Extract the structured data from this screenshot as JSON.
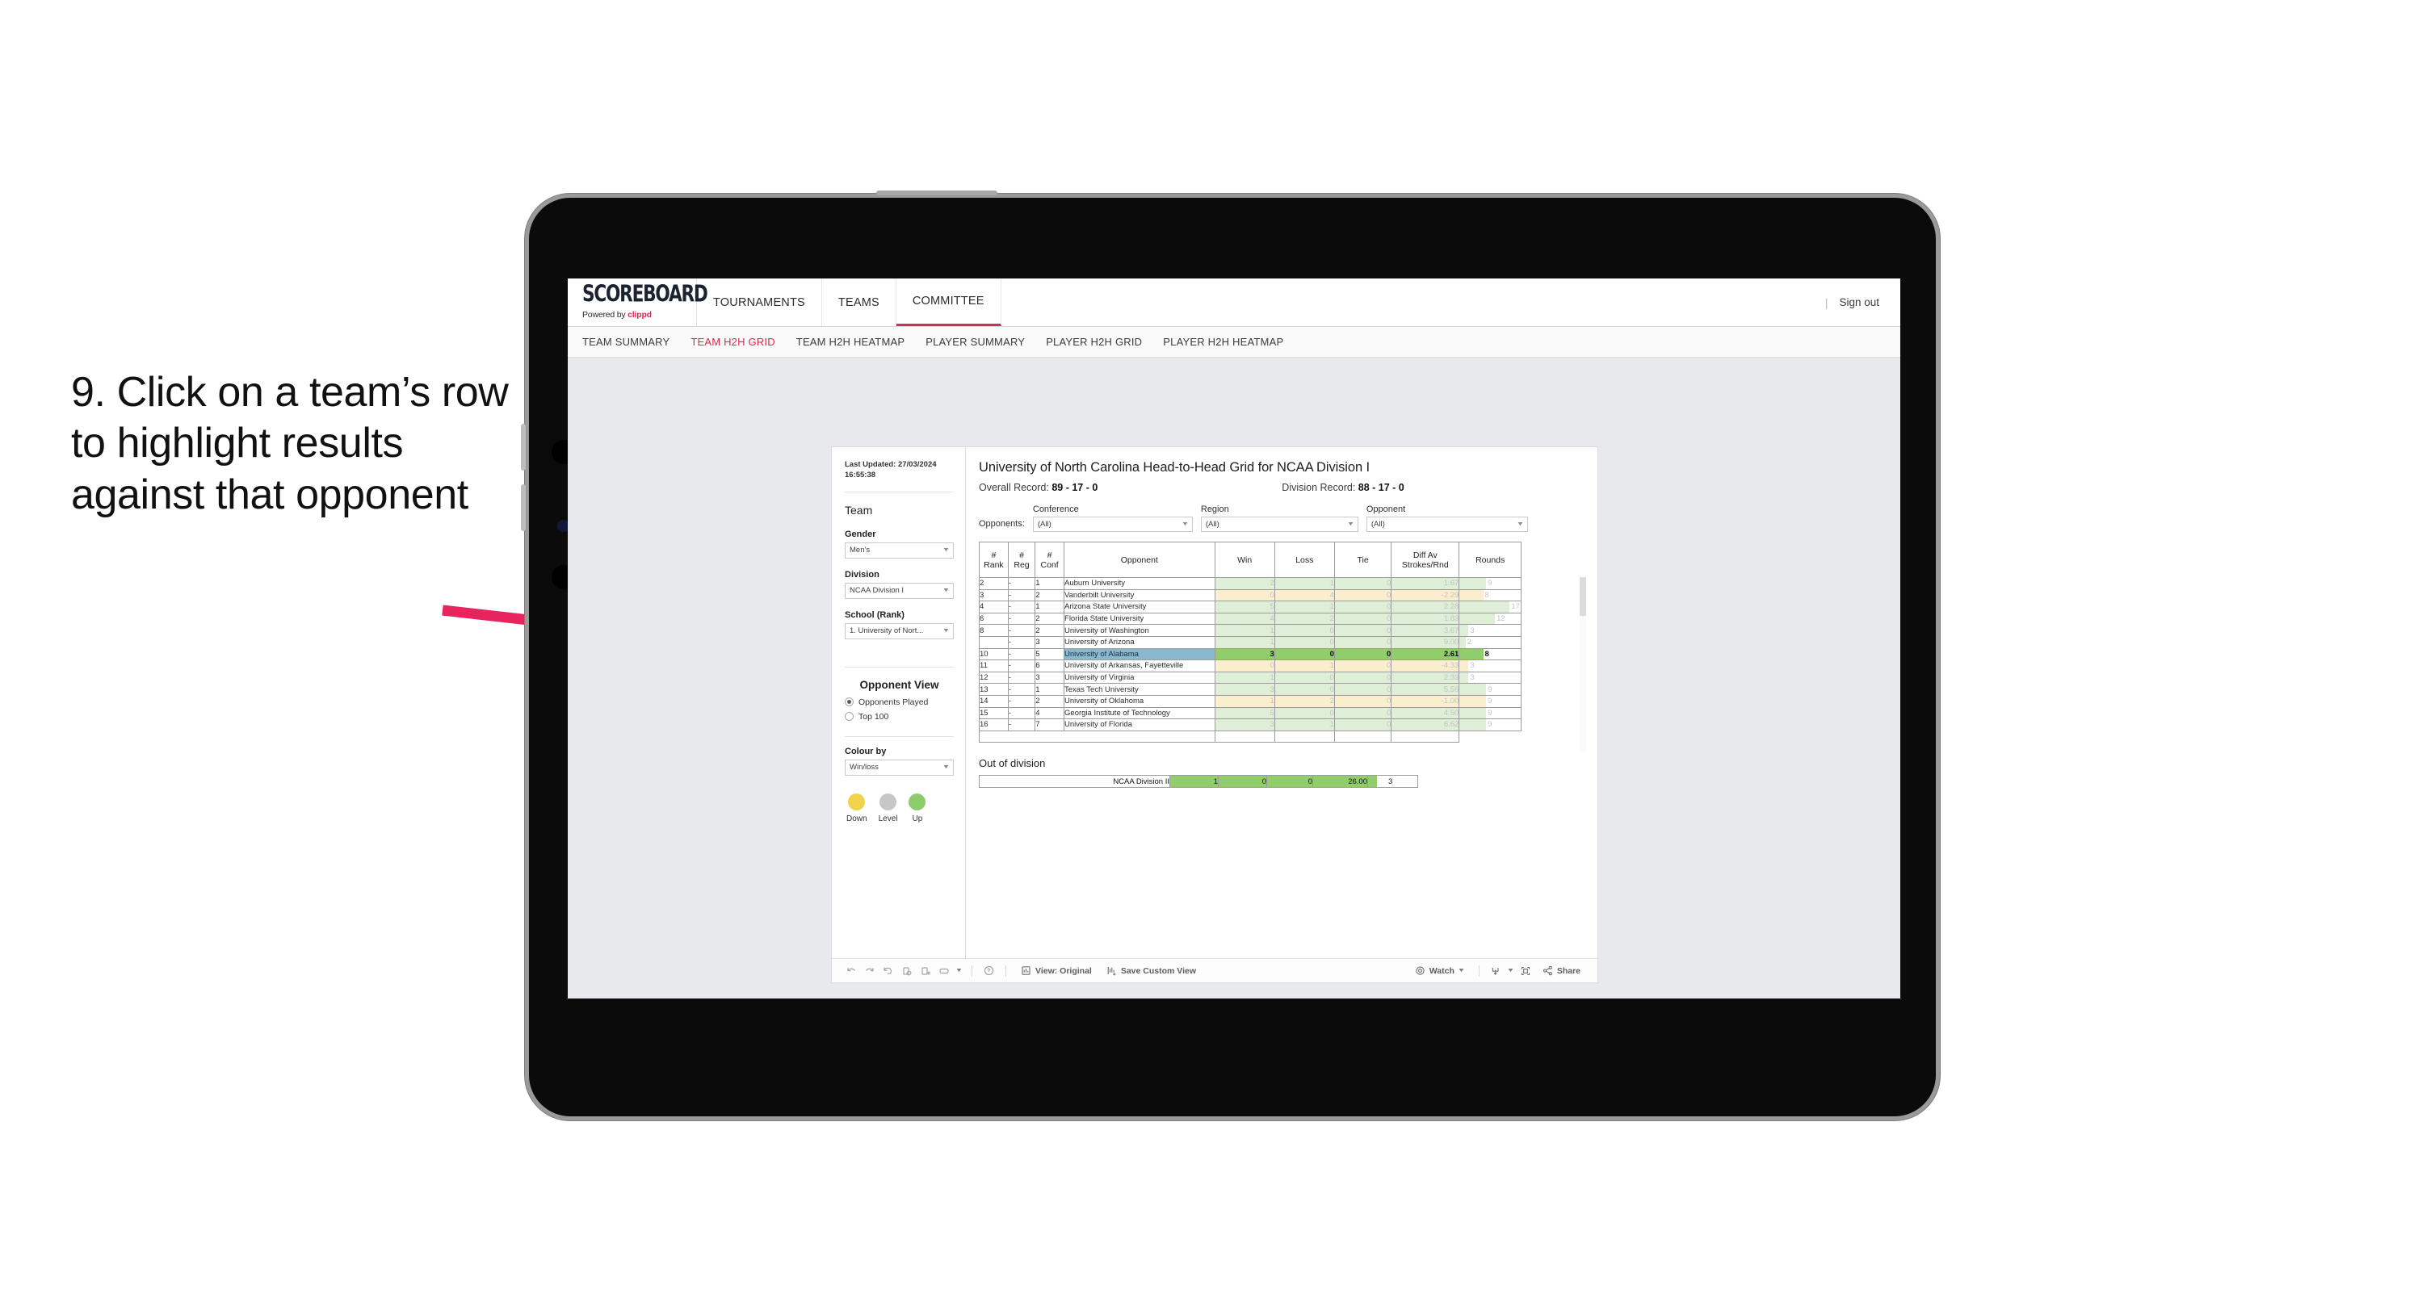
{
  "annotation": {
    "text": "9. Click on a team’s row to highlight results against that opponent",
    "arrow_color": "#e8245f"
  },
  "topbar": {
    "logo_main": "SCOREBOARD",
    "logo_sub_prefix": "Powered by ",
    "logo_sub_brand": "clippd",
    "nav": [
      {
        "label": "TOURNAMENTS",
        "active": false
      },
      {
        "label": "TEAMS",
        "active": false
      },
      {
        "label": "COMMITTEE",
        "active": true
      }
    ],
    "divider": "|",
    "signout": "Sign out"
  },
  "subnav": {
    "items": [
      {
        "label": "TEAM SUMMARY",
        "active": false
      },
      {
        "label": "TEAM H2H GRID",
        "active": true
      },
      {
        "label": "TEAM H2H HEATMAP",
        "active": false
      },
      {
        "label": "PLAYER SUMMARY",
        "active": false
      },
      {
        "label": "PLAYER H2H GRID",
        "active": false
      },
      {
        "label": "PLAYER H2H HEATMAP",
        "active": false
      }
    ],
    "active_color": "#e3264f"
  },
  "sidebar": {
    "last_updated": "Last Updated: 27/03/2024 16:55:38",
    "team_heading": "Team",
    "gender_label": "Gender",
    "gender_value": "Men’s",
    "division_label": "Division",
    "division_value": "NCAA Division I",
    "school_label": "School (Rank)",
    "school_value": "1. University of Nort...",
    "opponent_view_heading": "Opponent View",
    "opponent_view_options": [
      {
        "label": "Opponents Played",
        "selected": true
      },
      {
        "label": "Top 100",
        "selected": false
      }
    ],
    "colour_by_label": "Colour by",
    "colour_by_value": "Win/loss",
    "legend": [
      {
        "label": "Down",
        "color": "#f0d24b"
      },
      {
        "label": "Level",
        "color": "#c5c7c9"
      },
      {
        "label": "Up",
        "color": "#8ccc6d"
      }
    ]
  },
  "main": {
    "title": "University of North Carolina Head-to-Head Grid for NCAA Division I",
    "overall_record_label": "Overall Record: ",
    "overall_record_value": "89 - 17 - 0",
    "division_record_label": "Division Record: ",
    "division_record_value": "88 - 17 - 0",
    "opponents_label": "Opponents:",
    "filters": [
      {
        "label": "Conference",
        "value": "(All)"
      },
      {
        "label": "Region",
        "value": "(All)"
      },
      {
        "label": "Opponent",
        "value": "(All)"
      }
    ]
  },
  "chart_data": {
    "type": "table",
    "title": "University of North Carolina Head-to-Head Grid for NCAA Division I",
    "columns": [
      "# Rank",
      "# Reg",
      "# Conf",
      "Opponent",
      "Win",
      "Loss",
      "Tie",
      "Diff Av Strokes/Rnd",
      "Rounds"
    ],
    "header_lines": {
      "rank": [
        "#",
        "Rank"
      ],
      "reg": [
        "#",
        "Reg"
      ],
      "conf": [
        "#",
        "Conf"
      ],
      "opponent": [
        "Opponent"
      ],
      "win": [
        "Win"
      ],
      "loss": [
        "Loss"
      ],
      "tie": [
        "Tie"
      ],
      "diff": [
        "Diff Av",
        "Strokes/Rnd"
      ],
      "rounds": [
        "Rounds"
      ]
    },
    "rounds_max": 17,
    "rows": [
      {
        "rank": "2",
        "reg": "-",
        "conf": "1",
        "opponent": "Auburn University",
        "win": "2",
        "loss": "1",
        "tie": "0",
        "diff": "1.67",
        "rounds": "9",
        "result": "up",
        "selected": false
      },
      {
        "rank": "3",
        "reg": "-",
        "conf": "2",
        "opponent": "Vanderbilt University",
        "win": "0",
        "loss": "4",
        "tie": "0",
        "diff": "-2.29",
        "rounds": "8",
        "result": "down",
        "selected": false
      },
      {
        "rank": "4",
        "reg": "-",
        "conf": "1",
        "opponent": "Arizona State University",
        "win": "5",
        "loss": "1",
        "tie": "0",
        "diff": "2.28",
        "rounds": "17",
        "result": "up",
        "selected": false
      },
      {
        "rank": "6",
        "reg": "-",
        "conf": "2",
        "opponent": "Florida State University",
        "win": "4",
        "loss": "2",
        "tie": "0",
        "diff": "1.83",
        "rounds": "12",
        "result": "up",
        "selected": false
      },
      {
        "rank": "8",
        "reg": "-",
        "conf": "2",
        "opponent": "University of Washington",
        "win": "1",
        "loss": "0",
        "tie": "0",
        "diff": "3.67",
        "rounds": "3",
        "result": "up",
        "selected": false
      },
      {
        "rank": "",
        "reg": "-",
        "conf": "3",
        "opponent": "University of Arizona",
        "win": "1",
        "loss": "0",
        "tie": "0",
        "diff": "9.00",
        "rounds": "2",
        "result": "up",
        "selected": false
      },
      {
        "rank": "10",
        "reg": "-",
        "conf": "5",
        "opponent": "University of Alabama",
        "win": "3",
        "loss": "0",
        "tie": "0",
        "diff": "2.61",
        "rounds": "8",
        "result": "up",
        "selected": true
      },
      {
        "rank": "11",
        "reg": "-",
        "conf": "6",
        "opponent": "University of Arkansas, Fayetteville",
        "win": "0",
        "loss": "1",
        "tie": "0",
        "diff": "-4.33",
        "rounds": "3",
        "result": "down",
        "selected": false
      },
      {
        "rank": "12",
        "reg": "-",
        "conf": "3",
        "opponent": "University of Virginia",
        "win": "1",
        "loss": "0",
        "tie": "0",
        "diff": "2.33",
        "rounds": "3",
        "result": "up",
        "selected": false
      },
      {
        "rank": "13",
        "reg": "-",
        "conf": "1",
        "opponent": "Texas Tech University",
        "win": "3",
        "loss": "0",
        "tie": "0",
        "diff": "5.56",
        "rounds": "9",
        "result": "up",
        "selected": false
      },
      {
        "rank": "14",
        "reg": "-",
        "conf": "2",
        "opponent": "University of Oklahoma",
        "win": "1",
        "loss": "2",
        "tie": "0",
        "diff": "-1.00",
        "rounds": "9",
        "result": "down",
        "selected": false
      },
      {
        "rank": "15",
        "reg": "-",
        "conf": "4",
        "opponent": "Georgia Institute of Technology",
        "win": "5",
        "loss": "0",
        "tie": "0",
        "diff": "4.50",
        "rounds": "9",
        "result": "up",
        "selected": false
      },
      {
        "rank": "16",
        "reg": "-",
        "conf": "7",
        "opponent": "University of Florida",
        "win": "3",
        "loss": "1",
        "tie": "0",
        "diff": "6.62",
        "rounds": "9",
        "result": "up",
        "selected": false
      }
    ],
    "out_of_division": {
      "title": "Out of division",
      "label": "NCAA Division II",
      "win": "1",
      "loss": "0",
      "tie": "0",
      "diff": "26.00",
      "rounds": "3"
    },
    "colors": {
      "up_fill": "#dfeed6",
      "down_fill": "#faeecd",
      "selected_fill": "#8fce6b",
      "selected_opponent": "#8cb8cf",
      "rounds_bar_up": "#dfeed6",
      "rounds_bar_down": "#faeecd"
    }
  },
  "toolbar": {
    "view_label": "View: Original",
    "save_label": "Save Custom View",
    "watch_label": "Watch",
    "share_label": "Share"
  }
}
